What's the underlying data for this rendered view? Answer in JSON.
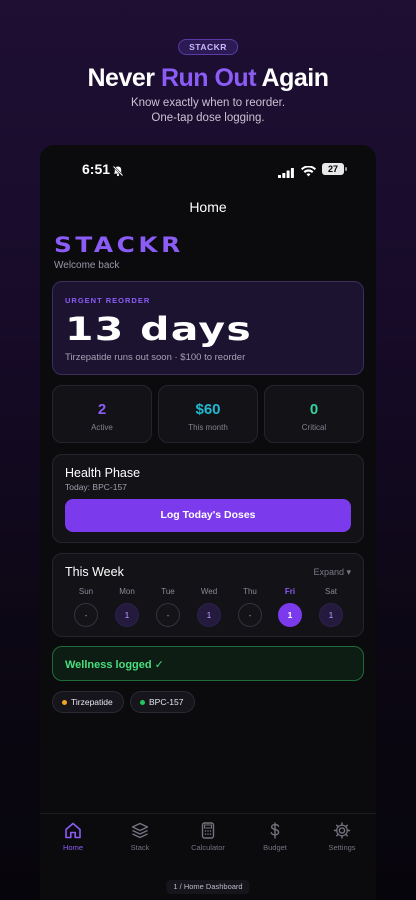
{
  "promo": {
    "badge": "STACKR",
    "title_part1": "Never ",
    "title_accent": "Run Out",
    "title_part2": " Again",
    "subtitle_line1": "Know exactly when to reorder.",
    "subtitle_line2": "One-tap dose logging."
  },
  "status_bar": {
    "time": "6:51",
    "battery": "27"
  },
  "nav": {
    "title": "Home"
  },
  "app": {
    "brand": "STACKR",
    "welcome": "Welcome back"
  },
  "urgent": {
    "label": "URGENT REORDER",
    "days": "13 days",
    "subtitle": "Tirzepatide runs out soon · $100 to reorder"
  },
  "stats": [
    {
      "value": "2",
      "label": "Active",
      "color": "#8b5cf6"
    },
    {
      "value": "$60",
      "label": "This month",
      "color": "#22b8cf"
    },
    {
      "value": "0",
      "label": "Critical",
      "color": "#34d399"
    }
  ],
  "health": {
    "title": "Health Phase",
    "subtitle": "Today: BPC-157",
    "button": "Log Today's Doses"
  },
  "week": {
    "title": "This Week",
    "expand": "Expand ▾",
    "days": [
      {
        "name": "Sun",
        "value": "-",
        "state": "empty"
      },
      {
        "name": "Mon",
        "value": "1",
        "state": "logged"
      },
      {
        "name": "Tue",
        "value": "-",
        "state": "empty"
      },
      {
        "name": "Wed",
        "value": "1",
        "state": "logged"
      },
      {
        "name": "Thu",
        "value": "-",
        "state": "empty"
      },
      {
        "name": "Fri",
        "value": "1",
        "state": "today"
      },
      {
        "name": "Sat",
        "value": "1",
        "state": "logged"
      }
    ]
  },
  "wellness": {
    "text": "Wellness logged ✓"
  },
  "chips": [
    {
      "label": "Tirzepatide",
      "dot_color": "#f5a524"
    },
    {
      "label": "BPC-157",
      "dot_color": "#22c55e"
    }
  ],
  "tabs": [
    {
      "label": "Home",
      "icon": "home-icon",
      "active": true
    },
    {
      "label": "Stack",
      "icon": "layers-icon",
      "active": false
    },
    {
      "label": "Calculator",
      "icon": "calculator-icon",
      "active": false
    },
    {
      "label": "Budget",
      "icon": "dollar-icon",
      "active": false
    },
    {
      "label": "Settings",
      "icon": "gear-icon",
      "active": false
    }
  ],
  "footer": {
    "label": "1 / Home Dashboard"
  },
  "colors": {
    "accent": "#8b5cf6",
    "button": "#7c3aed",
    "success": "#4ade80"
  }
}
